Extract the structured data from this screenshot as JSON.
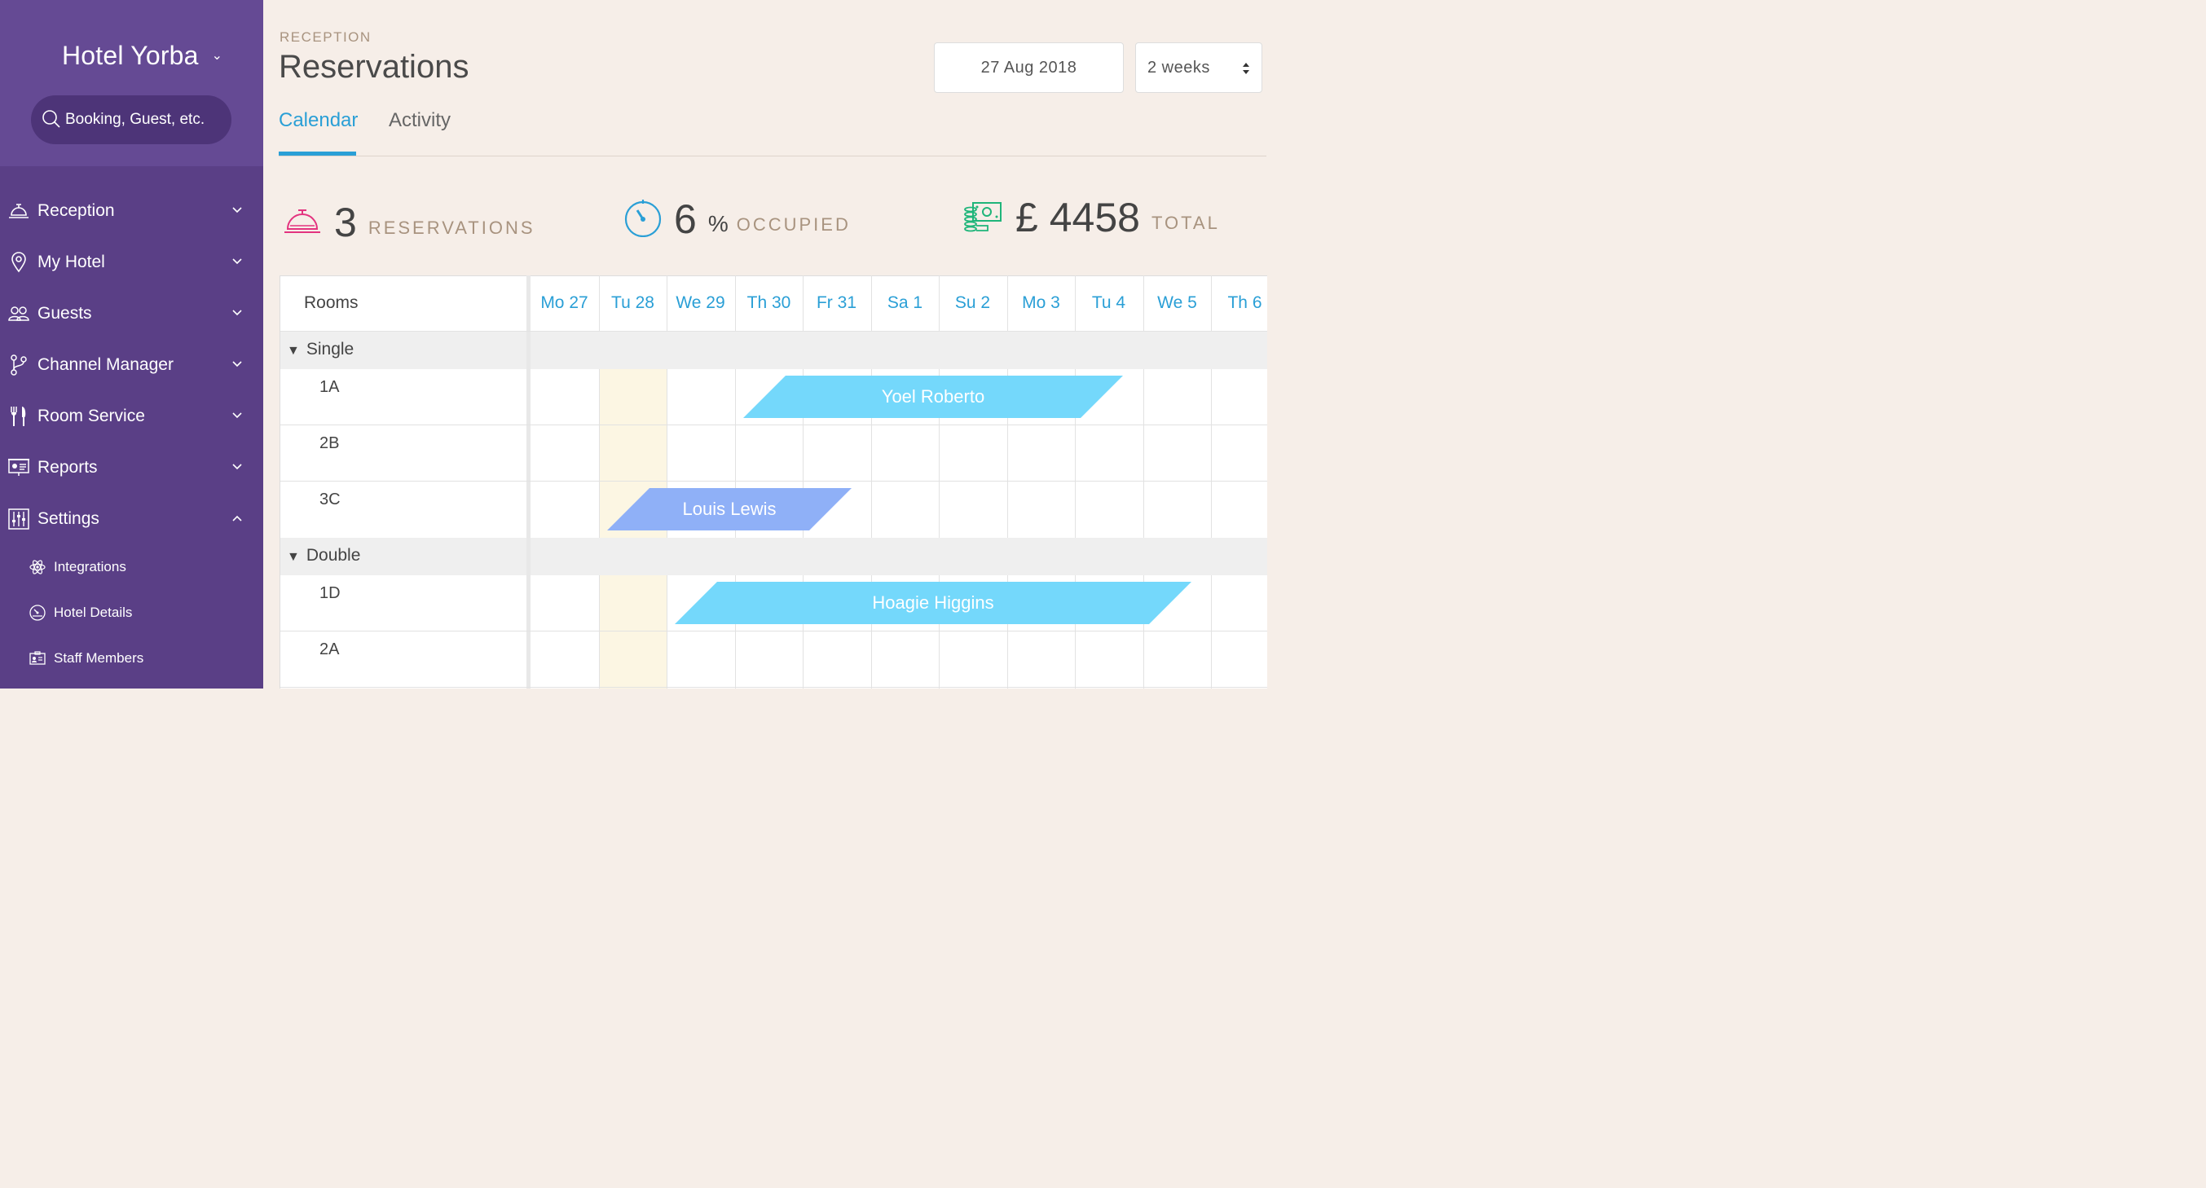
{
  "sidebar": {
    "hotel_name": "Hotel Yorba",
    "search_placeholder": "Booking, Guest, etc.",
    "items": [
      {
        "label": "Reception",
        "icon": "bell-icon"
      },
      {
        "label": "My Hotel",
        "icon": "location-pin-icon"
      },
      {
        "label": "Guests",
        "icon": "users-icon"
      },
      {
        "label": "Channel Manager",
        "icon": "branch-icon"
      },
      {
        "label": "Room Service",
        "icon": "cutlery-icon"
      },
      {
        "label": "Reports",
        "icon": "presentation-icon"
      },
      {
        "label": "Settings",
        "icon": "sliders-icon"
      }
    ],
    "sub_items": [
      {
        "label": "Integrations",
        "icon": "atom-icon"
      },
      {
        "label": "Hotel Details",
        "icon": "dashboard-icon"
      },
      {
        "label": "Staff Members",
        "icon": "id-card-icon"
      }
    ]
  },
  "header": {
    "breadcrumb": "RECEPTION",
    "title": "Reservations",
    "date": "27 Aug 2018",
    "range": "2 weeks"
  },
  "tabs": [
    "Calendar",
    "Activity"
  ],
  "stats": {
    "reservations": {
      "value": "3",
      "unit": "RESERVATIONS"
    },
    "occupied": {
      "value": "6",
      "pct": "%",
      "unit": "OCCUPIED"
    },
    "total": {
      "value": "£ 4458",
      "unit": "TOTAL"
    }
  },
  "calendar": {
    "rooms_header": "Rooms",
    "days": [
      "Mo 27",
      "Tu 28",
      "We 29",
      "Th 30",
      "Fr 31",
      "Sa 1",
      "Su 2",
      "Mo 3",
      "Tu 4",
      "We 5",
      "Th 6"
    ],
    "groups": [
      {
        "name": "Single",
        "rooms": [
          "1A",
          "2B",
          "3C"
        ]
      },
      {
        "name": "Double",
        "rooms": [
          "1D",
          "2A"
        ]
      }
    ],
    "bookings": [
      {
        "guest": "Yoel Roberto",
        "room": "1A"
      },
      {
        "guest": "Louis Lewis",
        "room": "3C"
      },
      {
        "guest": "Hoagie Higgins",
        "room": "1D"
      }
    ],
    "colors": {
      "booking_light": "#74d8fb",
      "booking_blue": "#8fb0f7",
      "today": "#fcf6e3"
    }
  }
}
